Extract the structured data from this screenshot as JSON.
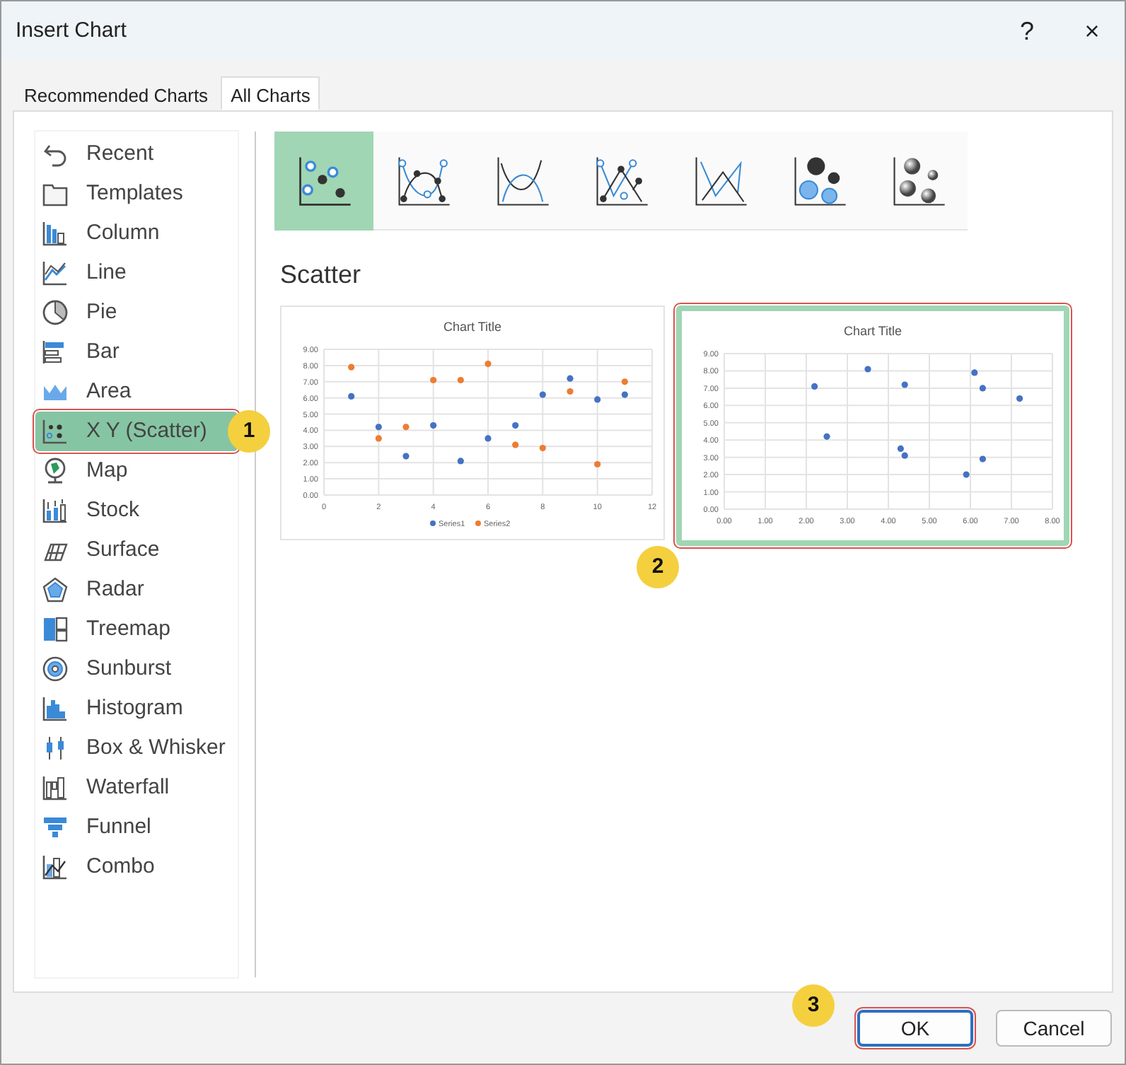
{
  "window": {
    "title": "Insert Chart",
    "help": "?",
    "close": "×"
  },
  "tabs": [
    {
      "label": "Recommended Charts",
      "selected": false
    },
    {
      "label": "All Charts",
      "selected": true
    }
  ],
  "chart_types": [
    {
      "label": "Recent",
      "selected": false
    },
    {
      "label": "Templates",
      "selected": false
    },
    {
      "label": "Column",
      "selected": false
    },
    {
      "label": "Line",
      "selected": false
    },
    {
      "label": "Pie",
      "selected": false
    },
    {
      "label": "Bar",
      "selected": false
    },
    {
      "label": "Area",
      "selected": false
    },
    {
      "label": "X Y (Scatter)",
      "selected": true,
      "callout": "1"
    },
    {
      "label": "Map",
      "selected": false
    },
    {
      "label": "Stock",
      "selected": false
    },
    {
      "label": "Surface",
      "selected": false
    },
    {
      "label": "Radar",
      "selected": false
    },
    {
      "label": "Treemap",
      "selected": false
    },
    {
      "label": "Sunburst",
      "selected": false
    },
    {
      "label": "Histogram",
      "selected": false
    },
    {
      "label": "Box & Whisker",
      "selected": false
    },
    {
      "label": "Waterfall",
      "selected": false
    },
    {
      "label": "Funnel",
      "selected": false
    },
    {
      "label": "Combo",
      "selected": false
    }
  ],
  "subtypes": [
    {
      "selected": true
    },
    {
      "selected": false
    },
    {
      "selected": false
    },
    {
      "selected": false
    },
    {
      "selected": false
    },
    {
      "selected": false
    },
    {
      "selected": false
    }
  ],
  "section_title": "Scatter",
  "previews": [
    {
      "selected": false,
      "chart_data": {
        "type": "scatter",
        "title": "Chart Title",
        "x": [
          1,
          2,
          3,
          4,
          5,
          6,
          7,
          8,
          9,
          10,
          11
        ],
        "series": [
          {
            "name": "Series1",
            "color": "#4472c4",
            "values": [
              6.1,
              4.2,
              2.4,
              4.3,
              2.1,
              3.5,
              4.3,
              6.2,
              7.2,
              5.9,
              6.2
            ]
          },
          {
            "name": "Series2",
            "color": "#ed7d31",
            "values": [
              7.9,
              3.5,
              4.2,
              7.1,
              7.1,
              8.1,
              3.1,
              2.9,
              6.4,
              1.9,
              7.0
            ]
          }
        ],
        "xlim": [
          0,
          12
        ],
        "ylim": [
          0,
          9
        ],
        "grid": true,
        "legend": true,
        "xticks": [
          0,
          2,
          4,
          6,
          8,
          10,
          12
        ],
        "yticks": [
          {
            "value": 0,
            "label": "0.00"
          },
          {
            "value": 1,
            "label": "1.00"
          },
          {
            "value": 2,
            "label": "2.00"
          },
          {
            "value": 3,
            "label": "3.00"
          },
          {
            "value": 4,
            "label": "4.00"
          },
          {
            "value": 5,
            "label": "5.00"
          },
          {
            "value": 6,
            "label": "6.00"
          },
          {
            "value": 7,
            "label": "7.00"
          },
          {
            "value": 8,
            "label": "8.00"
          },
          {
            "value": 9,
            "label": "9.00"
          }
        ]
      }
    },
    {
      "selected": true,
      "callout": "2",
      "chart_data": {
        "type": "scatter",
        "title": "Chart Title",
        "x": [
          2.2,
          2.5,
          3.5,
          4.3,
          4.4,
          4.4,
          5.9,
          6.1,
          6.3,
          6.3,
          7.2
        ],
        "series": [
          {
            "color": "#4472c4",
            "values": [
              7.1,
              4.2,
              8.1,
              3.5,
              3.1,
              7.2,
              2.0,
              7.9,
              7.0,
              2.9,
              6.4
            ]
          }
        ],
        "xlim": [
          0,
          8
        ],
        "ylim": [
          0,
          9
        ],
        "grid": true,
        "xticks": [
          {
            "value": 0,
            "label": "0.00"
          },
          {
            "value": 1,
            "label": "1.00"
          },
          {
            "value": 2,
            "label": "2.00"
          },
          {
            "value": 3,
            "label": "3.00"
          },
          {
            "value": 4,
            "label": "4.00"
          },
          {
            "value": 5,
            "label": "5.00"
          },
          {
            "value": 6,
            "label": "6.00"
          },
          {
            "value": 7,
            "label": "7.00"
          },
          {
            "value": 8,
            "label": "8.00"
          }
        ],
        "yticks": [
          {
            "value": 0,
            "label": "0.00"
          },
          {
            "value": 1,
            "label": "1.00"
          },
          {
            "value": 2,
            "label": "2.00"
          },
          {
            "value": 3,
            "label": "3.00"
          },
          {
            "value": 4,
            "label": "4.00"
          },
          {
            "value": 5,
            "label": "5.00"
          },
          {
            "value": 6,
            "label": "6.00"
          },
          {
            "value": 7,
            "label": "7.00"
          },
          {
            "value": 8,
            "label": "8.00"
          },
          {
            "value": 9,
            "label": "9.00"
          }
        ]
      }
    }
  ],
  "buttons": [
    {
      "label": "OK",
      "kind": "primary",
      "callout": "3"
    },
    {
      "label": "Cancel",
      "kind": "secondary"
    }
  ]
}
